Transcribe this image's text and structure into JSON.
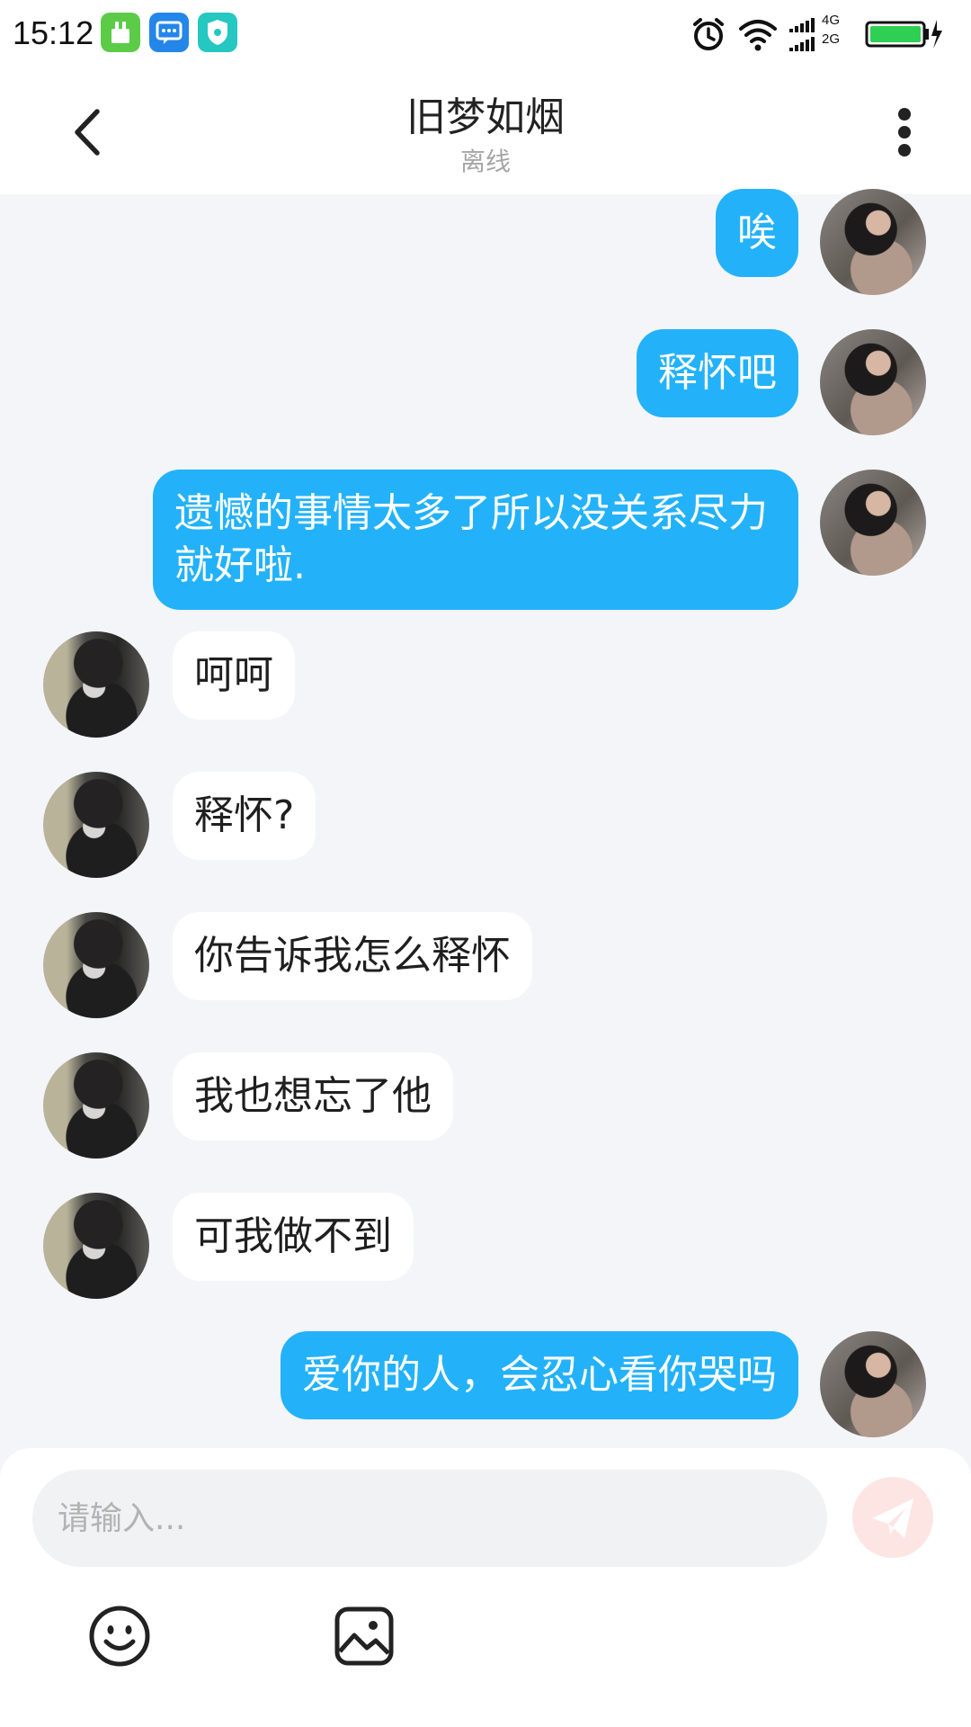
{
  "status_bar": {
    "time": "15:12",
    "network_labels": [
      "4G",
      "2G"
    ],
    "icons": [
      "cleaner-app-icon",
      "message-app-icon",
      "security-app-icon",
      "alarm-icon",
      "wifi-icon",
      "signal-icon",
      "battery-icon"
    ]
  },
  "header": {
    "title": "旧梦如烟",
    "status": "离线",
    "icons": [
      "chevron-left-icon",
      "more-vertical-icon"
    ]
  },
  "messages": [
    {
      "from": "me",
      "text": "唉"
    },
    {
      "from": "me",
      "text": "释怀吧"
    },
    {
      "from": "me",
      "text": "遗憾的事情太多了所以没关系尽力就好啦."
    },
    {
      "from": "other",
      "text": "呵呵"
    },
    {
      "from": "other",
      "text": "释怀?"
    },
    {
      "from": "other",
      "text": "你告诉我怎么释怀"
    },
    {
      "from": "other",
      "text": "我也想忘了他"
    },
    {
      "from": "other",
      "text": "可我做不到"
    },
    {
      "from": "me",
      "text": "爱你的人，会忍心看你哭吗"
    }
  ],
  "composer": {
    "placeholder": "请输入...",
    "value": "",
    "icons": [
      "send-icon",
      "emoji-icon",
      "image-icon"
    ]
  },
  "colors": {
    "my_bubble": "#23b2f9",
    "other_bubble": "#ffffff",
    "background": "#f4f5f8",
    "send_button": "#fde5e4"
  }
}
